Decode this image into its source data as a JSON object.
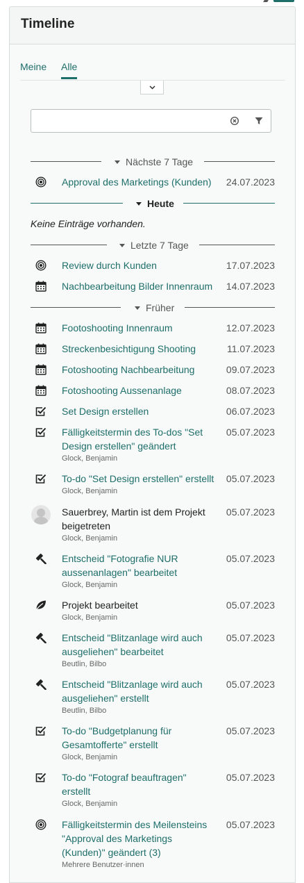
{
  "panel": {
    "title": "Timeline"
  },
  "tabs": [
    {
      "label": "Meine"
    },
    {
      "label": "Alle"
    }
  ],
  "search": {
    "value": "",
    "placeholder": ""
  },
  "sections": {
    "next7": "Nächste 7 Tage",
    "today": "Heute",
    "last7": "Letzte 7 Tage",
    "earlier": "Früher"
  },
  "today_empty": "Keine Einträge vorhanden.",
  "items": [
    {
      "icon": "milestone-icon",
      "title": "Approval des Marketings (Kunden)",
      "date": "24.07.2023",
      "user": ""
    },
    {
      "icon": "milestone-icon",
      "title": "Review durch Kunden",
      "date": "17.07.2023",
      "user": ""
    },
    {
      "icon": "calendar-icon",
      "title": "Nachbearbeitung Bilder Innenraum",
      "date": "14.07.2023",
      "user": ""
    },
    {
      "icon": "calendar-icon",
      "title": "Footoshooting Innenraum",
      "date": "12.07.2023",
      "user": ""
    },
    {
      "icon": "calendar-icon",
      "title": "Streckenbesichtigung Shooting",
      "date": "11.07.2023",
      "user": ""
    },
    {
      "icon": "calendar-icon",
      "title": "Fotoshooting Nachbearbeitung",
      "date": "09.07.2023",
      "user": ""
    },
    {
      "icon": "calendar-icon",
      "title": "Fotoshooting Aussenanlage",
      "date": "08.07.2023",
      "user": ""
    },
    {
      "icon": "todo-check-icon",
      "title": "Set Design erstellen",
      "date": "06.07.2023",
      "user": ""
    },
    {
      "icon": "todo-check-icon",
      "title": "Fälligkeitstermin des To-dos \"Set Design erstellen\" geändert",
      "date": "05.07.2023",
      "user": "Glock, Benjamin"
    },
    {
      "icon": "todo-check-icon",
      "title": "To-do \"Set Design erstellen\" erstellt",
      "date": "05.07.2023",
      "user": "Glock, Benjamin"
    },
    {
      "icon": "user-avatar-icon",
      "title": "Sauerbrey, Martin ist dem Projekt beigetreten",
      "date": "05.07.2023",
      "user": "Glock, Benjamin"
    },
    {
      "icon": "gavel-icon",
      "title": "Entscheid \"Fotografie NUR aussenanlagen\" bearbeitet",
      "date": "05.07.2023",
      "user": "Glock, Benjamin"
    },
    {
      "icon": "leaf-icon",
      "title": "Projekt bearbeitet",
      "date": "05.07.2023",
      "user": "Glock, Benjamin"
    },
    {
      "icon": "gavel-icon",
      "title": "Entscheid \"Blitzanlage wird auch ausgeliehen\" bearbeitet",
      "date": "05.07.2023",
      "user": "Beutlin, Bilbo"
    },
    {
      "icon": "gavel-icon",
      "title": "Entscheid \"Blitzanlage wird auch ausgeliehen\" erstellt",
      "date": "05.07.2023",
      "user": "Beutlin, Bilbo"
    },
    {
      "icon": "todo-check-icon",
      "title": "To-do \"Budgetplanung für Gesamtofferte\" erstellt",
      "date": "05.07.2023",
      "user": "Glock, Benjamin"
    },
    {
      "icon": "todo-check-icon",
      "title": "To-do \"Fotograf beauftragen\" erstellt",
      "date": "05.07.2023",
      "user": "Glock, Benjamin"
    },
    {
      "icon": "milestone-icon",
      "title": "Fälligkeitstermin des Meilensteins \"Approval des Marketings (Kunden)\" geändert (3)",
      "date": "05.07.2023",
      "user": "Mehrere Benutzer·innen"
    }
  ]
}
